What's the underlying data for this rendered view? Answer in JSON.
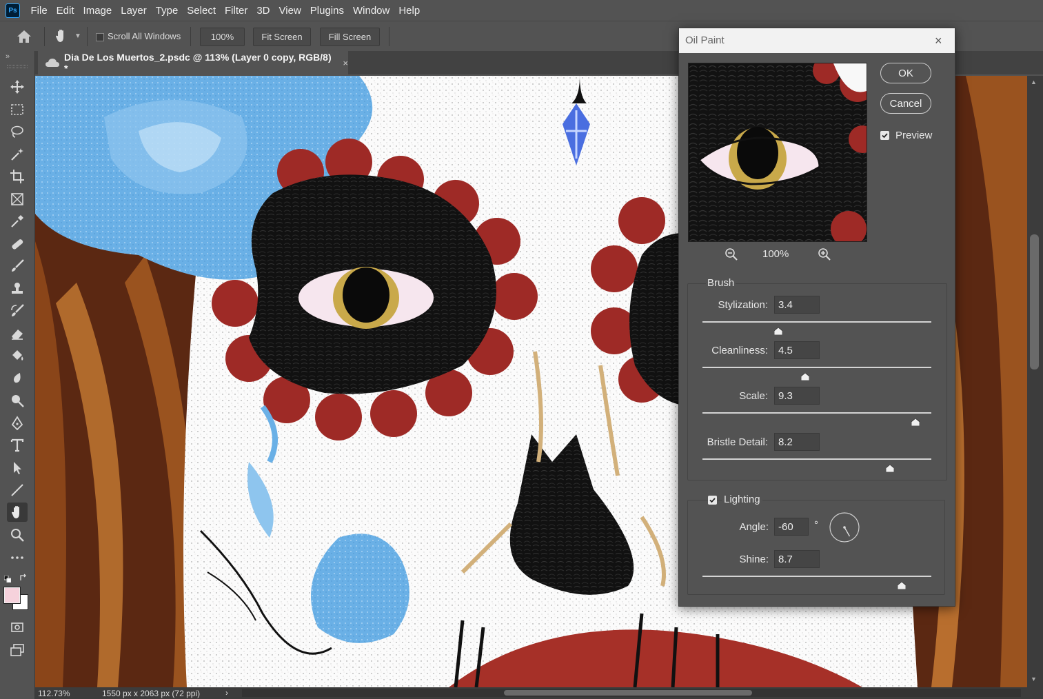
{
  "app": {
    "logo_text": "Ps"
  },
  "menu": [
    "File",
    "Edit",
    "Image",
    "Layer",
    "Type",
    "Select",
    "Filter",
    "3D",
    "View",
    "Plugins",
    "Window",
    "Help"
  ],
  "options": {
    "scroll_all_windows": "Scroll All Windows",
    "zoom_100": "100%",
    "fit_screen": "Fit Screen",
    "fill_screen": "Fill Screen"
  },
  "panel_collapse": "»",
  "document": {
    "tab_title": "Dia De Los Muertos_2.psdc @ 113% (Layer 0 copy, RGB/8) *",
    "tab_close": "×"
  },
  "status": {
    "zoom": "112.73%",
    "dimensions": "1550 px x 2063 px (72 ppi)",
    "arrow": "›"
  },
  "colors": {
    "foreground": "#f6d2dc",
    "background": "#ffffff",
    "accent": "#31a8ff"
  },
  "tools": [
    "move-tool",
    "marquee-tool",
    "lasso-tool",
    "magic-wand-tool",
    "crop-tool",
    "frame-tool",
    "eyedropper-tool",
    "healing-brush-tool",
    "brush-tool",
    "clone-stamp-tool",
    "history-brush-tool",
    "eraser-tool",
    "paint-bucket-tool",
    "blur-tool",
    "dodge-tool",
    "pen-tool",
    "type-tool",
    "path-selection-tool",
    "line-tool",
    "hand-tool",
    "zoom-tool",
    "more-tools"
  ],
  "dialog": {
    "title": "Oil Paint",
    "close": "×",
    "ok": "OK",
    "cancel": "Cancel",
    "preview_label": "Preview",
    "preview_checked": true,
    "zoom": "100%",
    "brush": {
      "group_label": "Brush",
      "stylization": {
        "label": "Stylization:",
        "value": "3.4",
        "fraction": 0.33
      },
      "cleanliness": {
        "label": "Cleanliness:",
        "value": "4.5",
        "fraction": 0.45
      },
      "scale": {
        "label": "Scale:",
        "value": "9.3",
        "fraction": 0.93
      },
      "bristle": {
        "label": "Bristle Detail:",
        "value": "8.2",
        "fraction": 0.82
      }
    },
    "lighting": {
      "label": "Lighting",
      "checked": true,
      "angle": {
        "label": "Angle:",
        "value": "-60",
        "unit": "°"
      },
      "shine": {
        "label": "Shine:",
        "value": "8.7",
        "fraction": 0.87
      }
    }
  }
}
